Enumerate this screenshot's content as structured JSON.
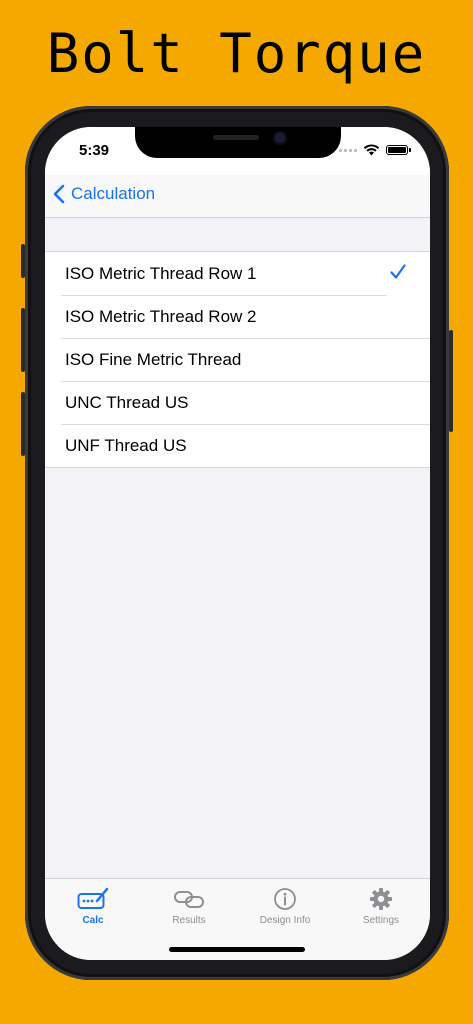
{
  "promo": {
    "title": "Bolt Torque"
  },
  "status": {
    "time": "5:39"
  },
  "nav": {
    "back_label": "Calculation"
  },
  "list": {
    "items": [
      {
        "label": "ISO Metric Thread Row 1",
        "selected": true
      },
      {
        "label": "ISO Metric Thread Row 2",
        "selected": false
      },
      {
        "label": "ISO Fine Metric Thread",
        "selected": false
      },
      {
        "label": "UNC Thread US",
        "selected": false
      },
      {
        "label": "UNF Thread US",
        "selected": false
      }
    ]
  },
  "tabs": [
    {
      "label": "Calc",
      "icon": "calc-pencil-icon",
      "active": true
    },
    {
      "label": "Results",
      "icon": "link-icon",
      "active": false
    },
    {
      "label": "Design Info",
      "icon": "info-icon",
      "active": false
    },
    {
      "label": "Settings",
      "icon": "gear-icon",
      "active": false
    }
  ],
  "colors": {
    "background": "#F5A800",
    "accent": "#1A73E8",
    "inactive": "#8E8E93"
  }
}
